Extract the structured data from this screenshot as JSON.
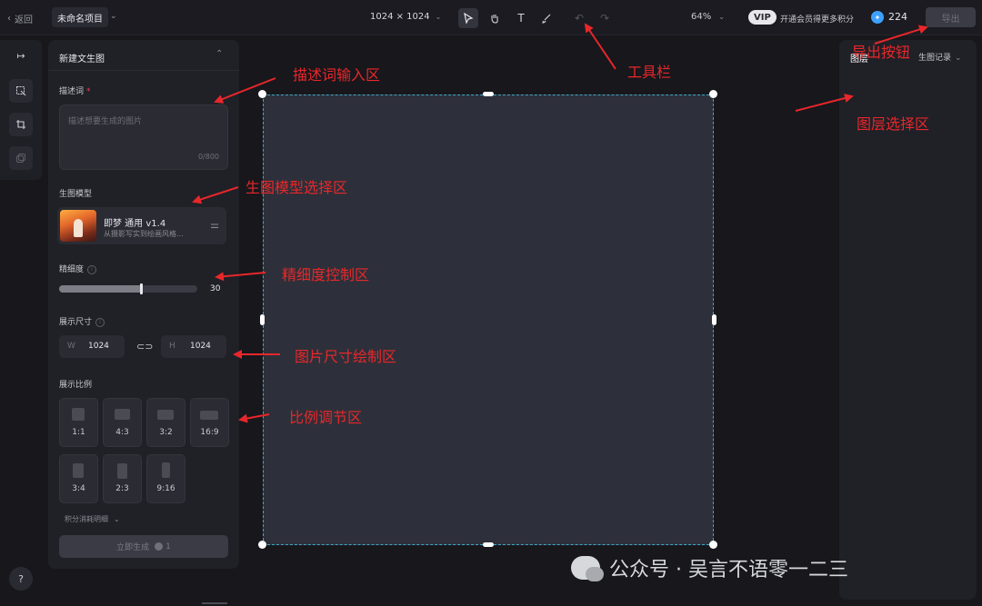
{
  "topbar": {
    "back_label": "返回",
    "project_name": "未命名项目",
    "canvas_size": "1024 × 1024",
    "zoom": "64%",
    "vip_badge": "VIP",
    "vip_text": "开通会员得更多积分",
    "points": "224",
    "export_label": "导出"
  },
  "tools": [
    "select-icon",
    "hand-icon",
    "text-icon",
    "brush-icon",
    "undo-icon",
    "redo-icon"
  ],
  "left_panel": {
    "title": "新建文生图",
    "prompt_label": "描述词",
    "prompt_required": "*",
    "prompt_placeholder": "描述想要生成的图片",
    "prompt_count": "0/800",
    "model_label": "生图模型",
    "model_name": "即梦 通用 v1.4",
    "model_desc": "从摄影写实到绘画风格...",
    "detail_label": "精细度",
    "detail_value": "30",
    "detail_fraction": 0.59,
    "size_label": "展示尺寸",
    "width_key": "W",
    "width_value": "1024",
    "height_key": "H",
    "height_value": "1024",
    "ratio_label": "展示比例",
    "ratios": [
      "1:1",
      "4:3",
      "3:2",
      "16:9",
      "3:4",
      "2:3",
      "9:16"
    ],
    "cost_label": "积分消耗明细",
    "generate_label": "立即生成",
    "generate_cost": "1"
  },
  "right_panel": {
    "tab_layers": "图层",
    "tab_history": "生图记录"
  },
  "annotations": {
    "prompt_area": "描述词输入区",
    "model_area": "生图模型选择区",
    "detail_area": "精细度控制区",
    "size_area": "图片尺寸绘制区",
    "ratio_area": "比例调节区",
    "toolbar": "工具栏",
    "export_button": "导出按钮",
    "layer_area": "图层选择区"
  },
  "watermark": "公众号 · 吴言不语零一二三",
  "colors": {
    "background": "#17171c",
    "panel": "#202027",
    "canvas": "#2d303a",
    "canvas_border": "#3fa9c8",
    "annotation": "#e8272a",
    "vip": "#e8e8ec",
    "points": "#3da0ff"
  }
}
